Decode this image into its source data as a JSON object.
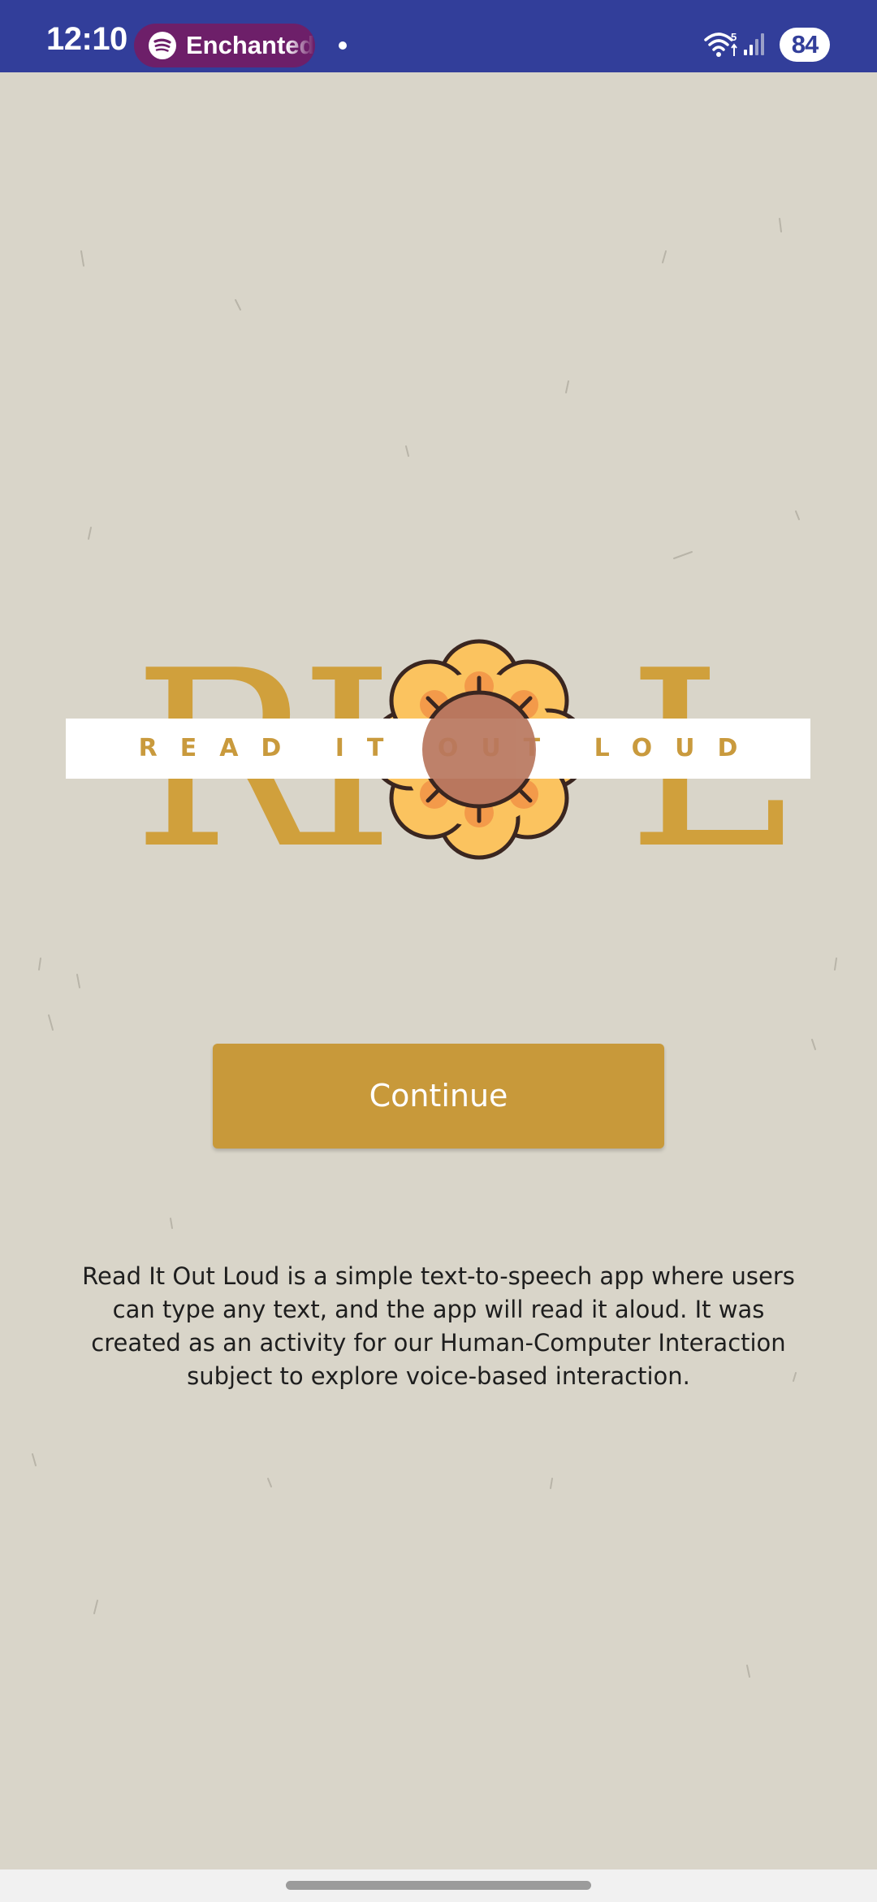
{
  "status_bar": {
    "time": "12:10",
    "media_title": "Enchanted",
    "battery": "84",
    "wifi_label": "5",
    "icons": [
      "spotify-icon",
      "wifi-icon",
      "signal-icon",
      "battery-icon"
    ]
  },
  "logo": {
    "letter_1": "R",
    "letter_2": "I",
    "letter_3": "L",
    "tagline": "READ IT OUT LOUD"
  },
  "continue_label": "Continue",
  "description": "Read It Out Loud is a simple text-to-speech app where users can type any text, and the app will read it aloud. It was created as an activity for our Human-Computer Interaction subject to explore voice-based interaction.",
  "colors": {
    "status_bar": "#323e9a",
    "media_pill": "#6d1f69",
    "background": "#d9d5c9",
    "brand_gold": "#c8993a",
    "flower_petal": "#fbc35f",
    "flower_center": "#b9775e"
  }
}
